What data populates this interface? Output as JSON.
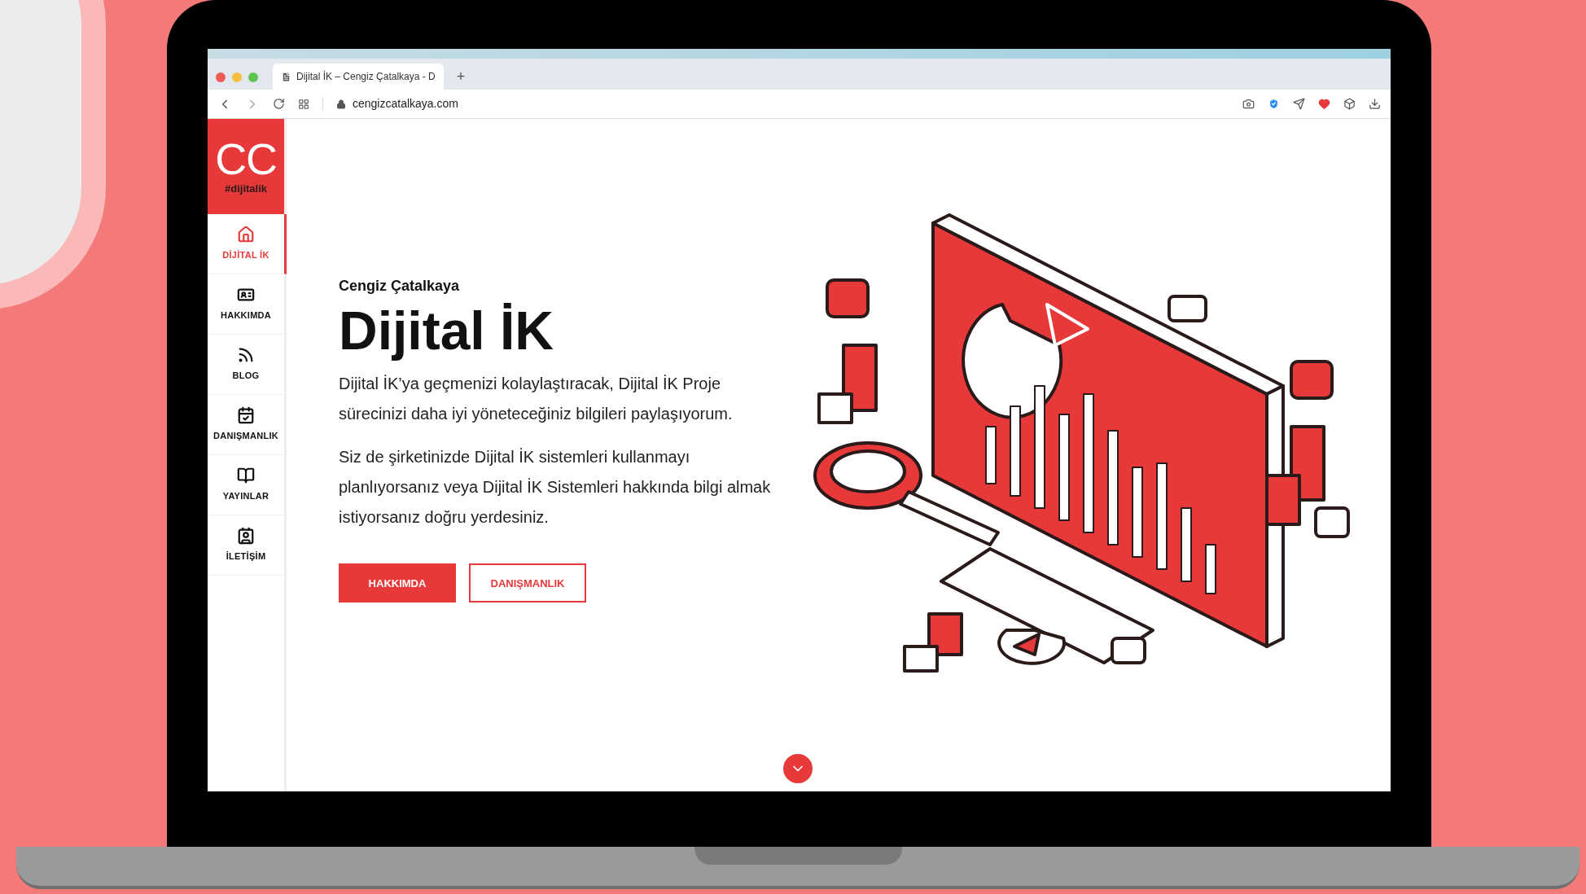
{
  "browser": {
    "tab_title": "Dijital İK – Cengiz Çatalkaya - D",
    "new_tab": "+",
    "url": "cengizcatalkaya.com"
  },
  "sidebar": {
    "logo": "CC",
    "logo_tag": "#dijitalik",
    "items": [
      {
        "label": "DİJİTAL İK",
        "selected": true
      },
      {
        "label": "HAKKIMDA",
        "selected": false
      },
      {
        "label": "BLOG",
        "selected": false
      },
      {
        "label": "DANIŞMANLIK",
        "selected": false
      },
      {
        "label": "YAYINLAR",
        "selected": false
      },
      {
        "label": "İLETİŞİM",
        "selected": false
      }
    ]
  },
  "hero": {
    "eyebrow": "Cengiz Çatalkaya",
    "title": "Dijital İK",
    "paragraphs": [
      "Dijital İK’ya geçmenizi kolaylaştıracak, Dijital İK Proje sürecinizi daha iyi yöneteceğiniz bilgileri paylaşıyorum.",
      "Siz de şirketinizde Dijital İK sistemleri kullanmayı planlıyorsanız veya Dijital İK Sistemleri hakkında bilgi almak istiyorsanız doğru yerdesiniz."
    ],
    "buttons": [
      {
        "label": "HAKKIMDA",
        "kind": "filled"
      },
      {
        "label": "DANIŞMANLIK",
        "kind": "outline"
      }
    ]
  }
}
